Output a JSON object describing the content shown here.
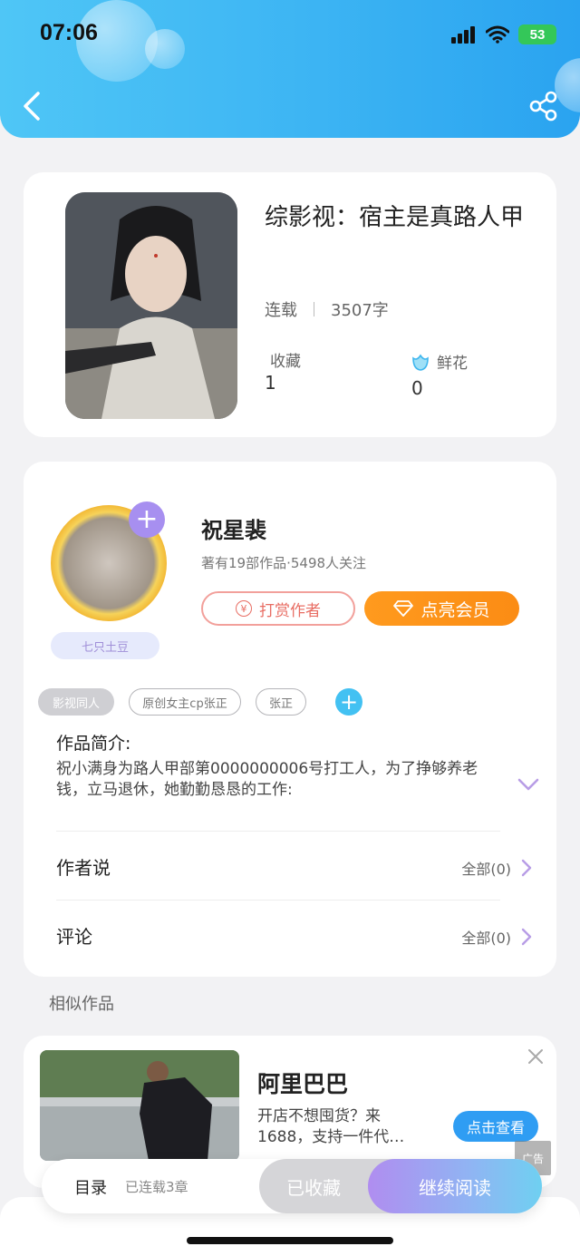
{
  "status_bar": {
    "time": "07:06",
    "battery": "53"
  },
  "book": {
    "title": "综影视：宿主是真路人甲",
    "status": "连载",
    "word_count": "3507字",
    "collect_label": "收藏",
    "collect_value": "1",
    "flower_label": "鲜花",
    "flower_value": "0"
  },
  "author": {
    "name": "祝星裴",
    "stats": "著有19部作品·5498人关注",
    "badge": "七只土豆",
    "tip_label": "打赏作者",
    "yen_symbol": "¥",
    "vip_label": "点亮会员"
  },
  "tags": [
    "影视同人",
    "原创女主cp张正",
    "张正"
  ],
  "intro": {
    "title": "作品简介:",
    "text": "祝小满身为路人甲部第0000000006号打工人，为了挣够养老钱，立马退休，她勤勤恳恳的工作:"
  },
  "rows": [
    {
      "title": "作者说",
      "right": "全部(0)"
    },
    {
      "title": "评论",
      "right": "全部(0)"
    }
  ],
  "similar": {
    "heading": "相似作品"
  },
  "ad": {
    "title": "阿里巴巴",
    "text": "开店不想囤货？来1688，支持一件代…",
    "button": "点击查看",
    "mark": "广告"
  },
  "bottom_bar": {
    "toc": "目录",
    "toc_count": "已连载3章",
    "collected": "已收藏",
    "read": "继续阅读"
  },
  "colors": {
    "header": "#3cb4f3",
    "vip": "#fb8c14",
    "accent_purple": "#a78ff0",
    "tip": "#e86d63"
  }
}
